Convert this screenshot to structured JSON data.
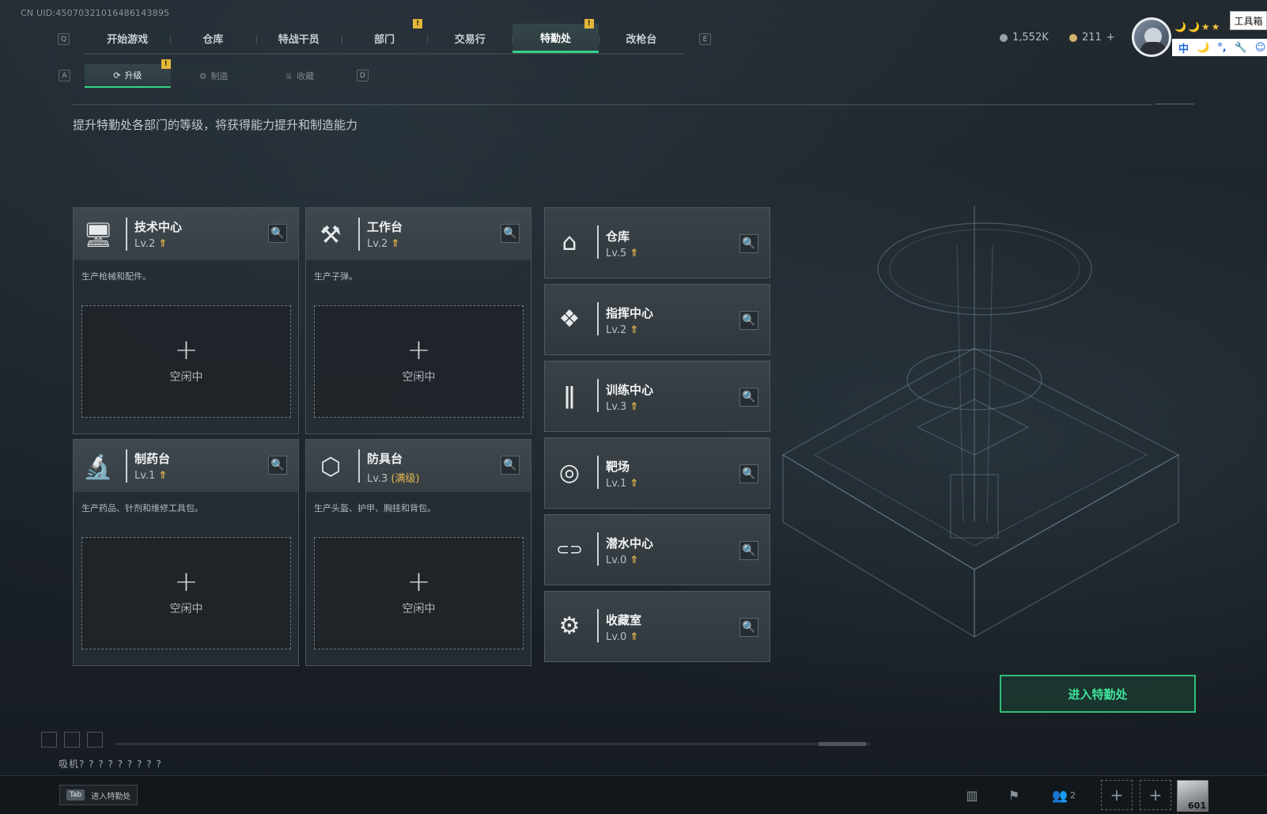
{
  "uid": "CN UID:4507032101648614389​5",
  "top_tabs": [
    {
      "label": "开始游戏",
      "alert": false
    },
    {
      "label": "仓库",
      "alert": false
    },
    {
      "label": "特战干员",
      "alert": false
    },
    {
      "label": "部门",
      "alert": true
    },
    {
      "label": "交易行",
      "alert": false
    },
    {
      "label": "特勤处",
      "alert": true,
      "active": true
    },
    {
      "label": "改枪台",
      "alert": false
    }
  ],
  "keys": {
    "left_tab": "Q",
    "right_tab": "E",
    "left_sub": "A",
    "right_sub": "D",
    "alert_mark": "!"
  },
  "sub_tabs": [
    {
      "label": "升级",
      "active": true,
      "alert": true
    },
    {
      "label": "制造",
      "active": false
    },
    {
      "label": "收藏",
      "active": false
    }
  ],
  "currency": {
    "silver": "1,552K",
    "gold": "211",
    "gold_add": "+"
  },
  "profile": {
    "stars": "🌙🌙★★",
    "toolbox": "工具箱"
  },
  "ime": {
    "lang": "中",
    "items": [
      "🌙",
      "°,",
      "🔧",
      "☺",
      "👕"
    ]
  },
  "description": "提升特勤处各部门的等级，将获得能力提升和制造能力",
  "lv_arrow": "⇑",
  "slot": {
    "plus": "+",
    "idle": "空闲中"
  },
  "search_icon": "🔍",
  "departments_big": [
    {
      "name": "技术中心",
      "level": "Lv.2",
      "desc": "生产枪械和配件。",
      "icon": "tech-center-icon",
      "glyph": "🖥"
    },
    {
      "name": "工作台",
      "level": "Lv.2",
      "desc": "生产子弹。",
      "icon": "workbench-icon",
      "glyph": "⚒"
    },
    {
      "name": "制药台",
      "level": "Lv.1",
      "desc": "生产药品、针剂和维修工具包。",
      "icon": "pharmacy-icon",
      "glyph": "🔬"
    },
    {
      "name": "防具台",
      "level": "Lv.3",
      "max": "(满级)",
      "desc": "生产头盔、护甲、胸挂和背包。",
      "icon": "armor-icon",
      "glyph": "⬡"
    }
  ],
  "departments_small": [
    {
      "name": "仓库",
      "level": "Lv.5",
      "icon": "warehouse-icon",
      "glyph": "⌂"
    },
    {
      "name": "指挥中心",
      "level": "Lv.2",
      "icon": "command-center-icon",
      "glyph": "❖"
    },
    {
      "name": "训练中心",
      "level": "Lv.3",
      "icon": "training-center-icon",
      "glyph": "ǁ"
    },
    {
      "name": "靶场",
      "level": "Lv.1",
      "icon": "shooting-range-icon",
      "glyph": "◎"
    },
    {
      "name": "潜水中心",
      "level": "Lv.0",
      "icon": "diving-center-icon",
      "glyph": "⊂⊃"
    },
    {
      "name": "收藏室",
      "level": "Lv.0",
      "icon": "collection-room-icon",
      "glyph": "⚙"
    }
  ],
  "enter_button": "进入特勤处",
  "bottom_status": "吸机? ? ? ? ? ? ? ? ?",
  "footer": {
    "tab_key": "Tab",
    "tab_label": "进入特勤处",
    "team_count": "2",
    "portrait_number": "601"
  },
  "colors": {
    "accent": "#35d08a",
    "alert": "#e3b63c",
    "level_up": "#e7b84a"
  }
}
